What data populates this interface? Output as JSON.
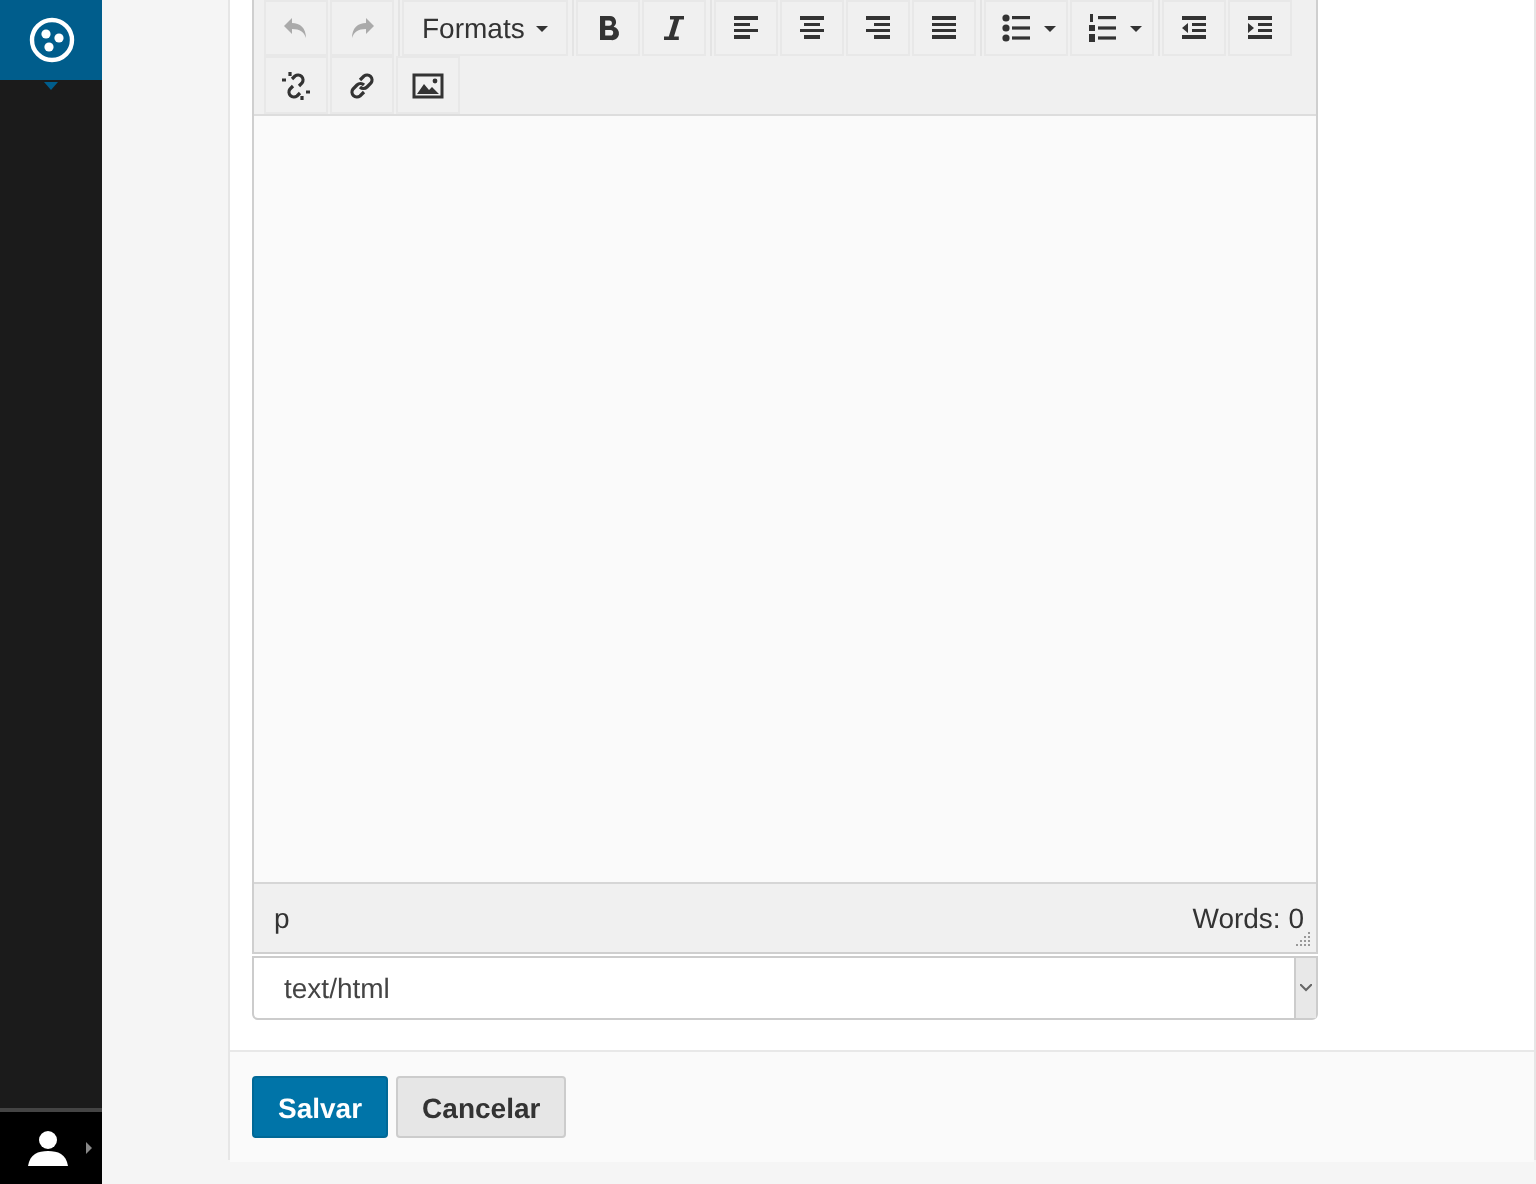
{
  "toolbar": {
    "rows": [
      [
        {
          "kind": "undo",
          "disabled": true
        },
        {
          "kind": "redo",
          "disabled": true
        },
        {
          "kind": "menu",
          "label": "Formats",
          "disabled": false
        },
        {
          "kind": "bold",
          "disabled": false
        },
        {
          "kind": "italic",
          "disabled": false
        },
        {
          "kind": "align-left",
          "disabled": false
        },
        {
          "kind": "align-center",
          "disabled": false
        },
        {
          "kind": "align-right",
          "disabled": false
        },
        {
          "kind": "justify",
          "disabled": false
        },
        {
          "kind": "bullet-list",
          "dropdown": true,
          "disabled": false
        },
        {
          "kind": "numbered-list",
          "dropdown": true,
          "disabled": false
        },
        {
          "kind": "outdent",
          "disabled": false
        },
        {
          "kind": "indent",
          "disabled": false
        }
      ],
      [
        {
          "kind": "unlink",
          "disabled": false
        },
        {
          "kind": "link",
          "disabled": false
        },
        {
          "kind": "image",
          "disabled": false
        }
      ]
    ]
  },
  "editor": {
    "path": "p",
    "word_count": "Words: 0"
  },
  "format_select": {
    "value": "text/html"
  },
  "buttons": [
    {
      "label": "Salvar",
      "kind": "primary"
    },
    {
      "label": "Cancelar",
      "kind": "secondary"
    }
  ]
}
